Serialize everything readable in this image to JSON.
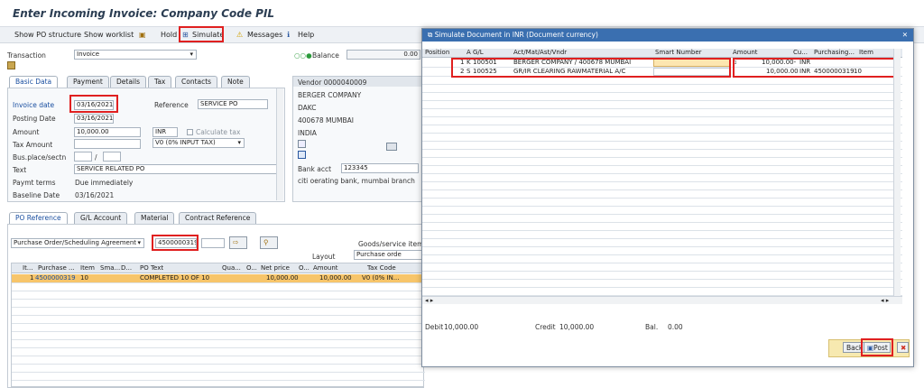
{
  "title": "Enter Incoming Invoice: Company Code PIL",
  "toolbar": {
    "show_po_structure": "Show PO structure",
    "show_worklist": "Show worklist",
    "hold": "Hold",
    "simulate": "Simulate",
    "messages": "Messages",
    "help": "Help"
  },
  "header": {
    "transaction_label": "Transaction",
    "transaction_value": "Invoice",
    "balance_label": "Balance",
    "balance_value": "0.00"
  },
  "tabs": [
    "Basic Data",
    "Payment",
    "Details",
    "Tax",
    "Contacts",
    "Note"
  ],
  "basic_data": {
    "invoice_date_label": "Invoice date",
    "invoice_date": "03/16/2021",
    "reference_label": "Reference",
    "reference": "SERVICE PO",
    "posting_date_label": "Posting Date",
    "posting_date": "03/16/2021",
    "amount_label": "Amount",
    "amount": "10,000.00",
    "currency": "INR",
    "calc_tax_label": "Calculate tax",
    "tax_amount_label": "Tax Amount",
    "tax_code": "V0 (0% INPUT TAX)",
    "bus_place_label": "Bus.place/sectn",
    "bus_place_sep": "/",
    "text_label": "Text",
    "text": "SERVICE RELATED PO",
    "paymt_terms_label": "Paymt terms",
    "paymt_terms": "Due immediately",
    "baseline_label": "Baseline Date",
    "baseline": "03/16/2021"
  },
  "vendor": {
    "title": "Vendor 0000040009",
    "lines": [
      "BERGER COMPANY",
      "DAKC",
      "400678 MUMBAI",
      "INDIA"
    ],
    "bank_acct_label": "Bank acct",
    "bank_acct": "123345",
    "bank_name": "citi oerating bank, mumbai branch"
  },
  "ref_tabs": [
    "PO Reference",
    "G/L Account",
    "Material",
    "Contract Reference"
  ],
  "po_ref": {
    "doc_type": "Purchase Order/Scheduling Agreement",
    "po_number": "4500000319",
    "layout_label": "Layout",
    "gs_items_label": "Goods/service items",
    "layout_value": "Purchase orde",
    "columns": [
      "It...",
      "Purchase ...",
      "Item",
      "Sma...",
      "D...",
      "PO Text",
      "Qua...",
      "O...",
      "Net price",
      "O...",
      "Amount",
      "Tax Code"
    ],
    "rows": [
      {
        "it": "1",
        "po": "4500000319",
        "item": "10",
        "text": "COMPLETED 10 OF 10",
        "net": "10,000.00",
        "amount": "10,000.00",
        "tax": "V0 (0% IN..."
      }
    ]
  },
  "sim": {
    "title": "Simulate Document in INR (Document currency)",
    "columns": [
      "Position",
      "A",
      "G/L",
      "Act/Mat/Ast/Vndr",
      "Smart Number",
      "Amount",
      "Cu...",
      "Purchasing...",
      "Item"
    ],
    "rows": [
      {
        "pos": "1",
        "a": "K",
        "gl": "100501",
        "vendor": "BERGER COMPANY / 400678 MUMBAI",
        "smart": "",
        "amount": "10,000.00-",
        "cur": "INR",
        "po": "",
        "item": ""
      },
      {
        "pos": "2",
        "a": "S",
        "gl": "100525",
        "vendor": "GR/IR CLEARING RAWMATERIAL A/C",
        "smart": "",
        "amount": "10,000.00",
        "cur": "INR",
        "po": "4500000319",
        "item": "10"
      }
    ],
    "debit_label": "Debit",
    "debit": "10,000.00",
    "credit_label": "Credit",
    "credit": "10,000.00",
    "bal_label": "Bal.",
    "bal": "0.00",
    "back": "Back",
    "post": "Post"
  },
  "colors": {
    "accent": "#1a4fa0",
    "highlight_row": "#f7c56a",
    "red": "#e02020"
  }
}
